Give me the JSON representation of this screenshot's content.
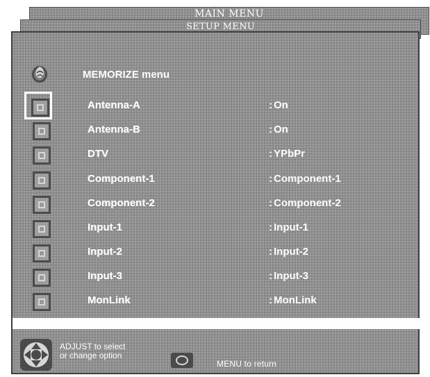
{
  "header": {
    "main_menu_title": "MAIN MENU",
    "setup_menu_title": "SETUP MENU"
  },
  "memorize": {
    "title": "MEMORIZE menu",
    "icon": "memorize-icon"
  },
  "items": [
    {
      "label": "Antenna-A",
      "value": "On",
      "selected": true
    },
    {
      "label": "Antenna-B",
      "value": "On",
      "selected": false
    },
    {
      "label": "DTV",
      "value": "YPbPr",
      "selected": false
    },
    {
      "label": "Component-1",
      "value": "Component-1",
      "selected": false
    },
    {
      "label": "Component-2",
      "value": "Component-2",
      "selected": false
    },
    {
      "label": "Input-1",
      "value": "Input-1",
      "selected": false
    },
    {
      "label": "Input-2",
      "value": "Input-2",
      "selected": false
    },
    {
      "label": "Input-3",
      "value": "Input-3",
      "selected": false
    },
    {
      "label": "MonLink",
      "value": "MonLink",
      "selected": false
    }
  ],
  "footer": {
    "adjust_line_1": "ADJUST to select",
    "adjust_line_2": "or change option",
    "menu_return": "MENU to return"
  },
  "colors": {
    "panel_gray": "#8f8f8f",
    "text": "#ffffff",
    "border": "#3d3d3d",
    "icon_dark": "#4b4b4b",
    "icon_light": "#d7d7d7"
  },
  "icons": {
    "row_icon": "item-square-icon",
    "adjust": "directional-pad-icon",
    "menu": "menu-button-icon"
  }
}
